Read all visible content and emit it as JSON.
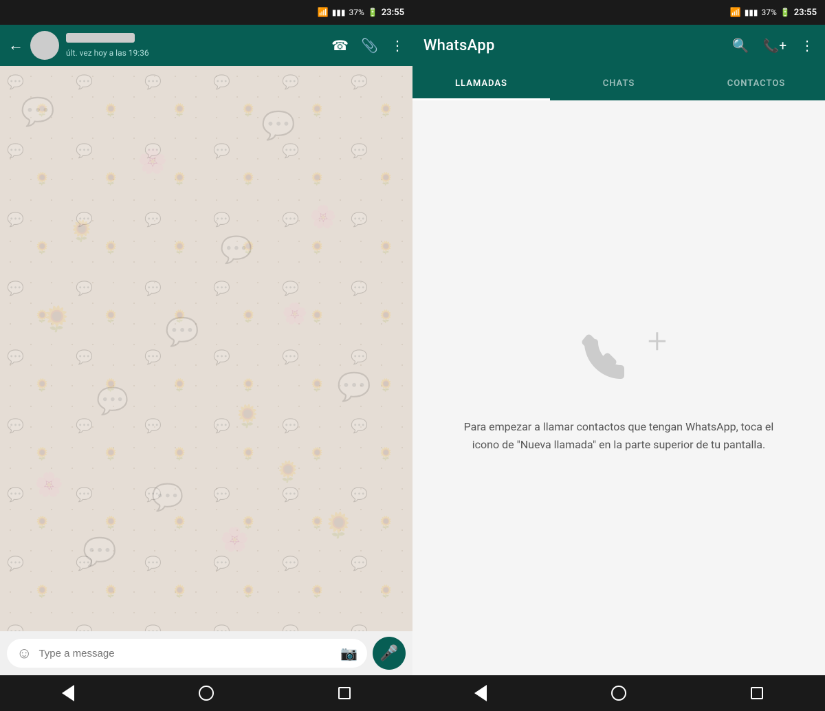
{
  "left": {
    "status_bar": {
      "wifi": "📶",
      "signal": "📡",
      "battery": "37%",
      "battery_icon": "🔋",
      "time": "23:55"
    },
    "header": {
      "contact_status": "últ. vez hoy a las 19:36"
    },
    "message_input": {
      "placeholder": "Type a message"
    },
    "nav": {
      "back_label": "◀",
      "home_label": "○",
      "recents_label": "□"
    }
  },
  "right": {
    "status_bar": {
      "time": "23:55",
      "battery": "37%"
    },
    "header": {
      "title": "WhatsApp"
    },
    "tabs": [
      {
        "id": "llamadas",
        "label": "LLAMADAS",
        "active": true
      },
      {
        "id": "chats",
        "label": "CHATS",
        "active": false
      },
      {
        "id": "contactos",
        "label": "CONTACTOS",
        "active": false
      }
    ],
    "empty_calls": {
      "description": "Para empezar a llamar contactos que tengan WhatsApp, toca el icono de \"Nueva llamada\" en la parte superior de tu pantalla."
    },
    "nav": {
      "back_label": "◀",
      "home_label": "○",
      "recents_label": "□"
    }
  }
}
